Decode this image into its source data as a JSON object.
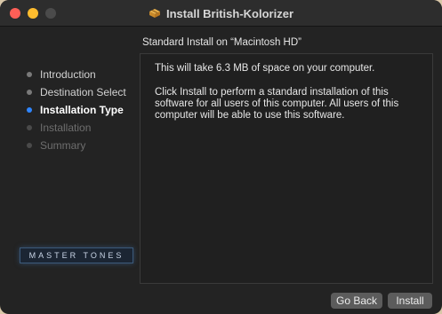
{
  "window": {
    "title": "Install British-Kolorizer",
    "title_icon": "package-icon"
  },
  "subtitle": "Standard Install on “Macintosh HD”",
  "sidebar": {
    "steps": [
      {
        "label": "Introduction",
        "state": "done"
      },
      {
        "label": "Destination Select",
        "state": "done"
      },
      {
        "label": "Installation Type",
        "state": "active"
      },
      {
        "label": "Installation",
        "state": "future"
      },
      {
        "label": "Summary",
        "state": "future"
      }
    ],
    "logo_text": "MASTER TONES"
  },
  "panel": {
    "space_text": "This will take 6.3 MB of space on your computer.",
    "install_text": "Click Install to perform a standard installation of this software for all users of this computer. All users of this computer will be able to use this software."
  },
  "buttons": {
    "back": "Go Back",
    "install": "Install"
  },
  "colors": {
    "active_step": "#2f86ff",
    "close": "#ff5f57",
    "minimize": "#febc2e"
  }
}
